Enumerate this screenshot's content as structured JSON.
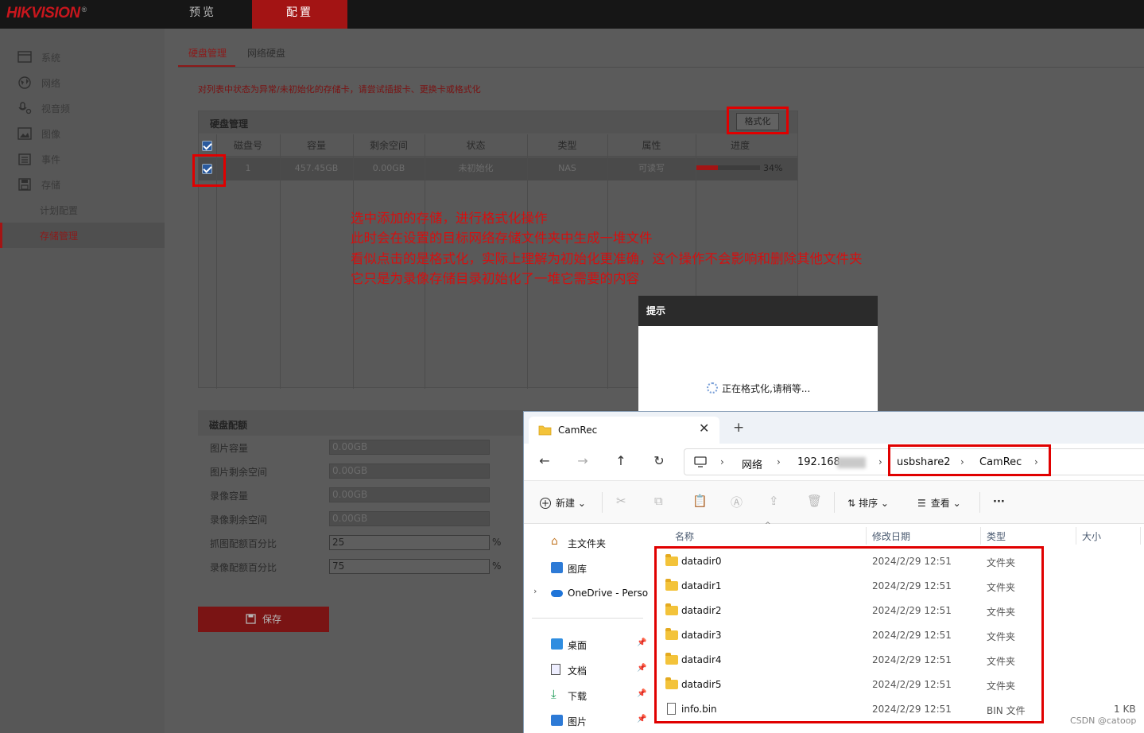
{
  "topbar": {
    "logo": "HIKVISION",
    "logo_mark": "®",
    "nav": [
      "预览",
      "配置"
    ],
    "active_nav": "配置"
  },
  "sidebar": {
    "items": [
      {
        "label": "系统",
        "icon": "monitor-icon"
      },
      {
        "label": "网络",
        "icon": "globe-icon"
      },
      {
        "label": "视音频",
        "icon": "mic-icon"
      },
      {
        "label": "图像",
        "icon": "image-icon"
      },
      {
        "label": "事件",
        "icon": "calendar-icon"
      },
      {
        "label": "存储",
        "icon": "save-icon"
      }
    ],
    "subitems": [
      "计划配置",
      "存储管理"
    ],
    "active": "存储管理"
  },
  "tabs": [
    "硬盘管理",
    "网络硬盘"
  ],
  "warning": "对列表中状态为异常/未初始化的存储卡，请尝试插拔卡、更换卡或格式化",
  "disk_panel": {
    "title": "硬盘管理",
    "format_button": "格式化",
    "columns": [
      "磁盘号",
      "容量",
      "剩余空间",
      "状态",
      "类型",
      "属性",
      "进度"
    ],
    "rows": [
      {
        "no": "1",
        "capacity": "457.45GB",
        "free": "0.00GB",
        "status": "未初始化",
        "type": "NAS",
        "attr": "可读写",
        "progress": 34,
        "progress_text": "34%"
      }
    ]
  },
  "annotation": [
    "选中添加的存储，进行格式化操作",
    "此时会在设置的目标网络存储文件夹中生成一堆文件",
    "看似点击的是格式化，实际上理解为初始化更准确，这个操作不会影响和删除其他文件夹",
    "它只是为录像存储目录初始化了一堆它需要的内容"
  ],
  "quota": {
    "title": "磁盘配额",
    "fields": [
      {
        "label": "图片容量",
        "value": "0.00GB",
        "unit": ""
      },
      {
        "label": "图片剩余空间",
        "value": "0.00GB",
        "unit": ""
      },
      {
        "label": "录像容量",
        "value": "0.00GB",
        "unit": ""
      },
      {
        "label": "录像剩余空间",
        "value": "0.00GB",
        "unit": ""
      },
      {
        "label": "抓图配额百分比",
        "value": "25",
        "unit": "%"
      },
      {
        "label": "录像配额百分比",
        "value": "75",
        "unit": "%"
      }
    ],
    "save_button": "保存"
  },
  "dialog": {
    "title": "提示",
    "message": "正在格式化,请稍等..."
  },
  "explorer": {
    "tab_title": "CamRec",
    "address": [
      "网络",
      "192.168.",
      "usbshare2",
      "CamRec"
    ],
    "toolbar": {
      "new": "新建",
      "sort": "排序",
      "view": "查看",
      "more": "···"
    },
    "sidebar": [
      {
        "label": "主文件夹",
        "icon": "home-icon",
        "pinned": false
      },
      {
        "label": "图库",
        "icon": "gallery-icon",
        "pinned": false
      },
      {
        "label": "OneDrive - Perso",
        "icon": "cloud-icon",
        "pinned": false
      },
      {
        "label": "桌面",
        "icon": "desktop-icon",
        "pinned": true
      },
      {
        "label": "文档",
        "icon": "document-icon",
        "pinned": true
      },
      {
        "label": "下载",
        "icon": "download-icon",
        "pinned": true
      },
      {
        "label": "图片",
        "icon": "pictures-icon",
        "pinned": true
      }
    ],
    "columns": [
      "名称",
      "修改日期",
      "类型",
      "大小"
    ],
    "files": [
      {
        "name": "datadir0",
        "date": "2024/2/29 12:51",
        "type": "文件夹",
        "size": "",
        "kind": "folder"
      },
      {
        "name": "datadir1",
        "date": "2024/2/29 12:51",
        "type": "文件夹",
        "size": "",
        "kind": "folder"
      },
      {
        "name": "datadir2",
        "date": "2024/2/29 12:51",
        "type": "文件夹",
        "size": "",
        "kind": "folder"
      },
      {
        "name": "datadir3",
        "date": "2024/2/29 12:51",
        "type": "文件夹",
        "size": "",
        "kind": "folder"
      },
      {
        "name": "datadir4",
        "date": "2024/2/29 12:51",
        "type": "文件夹",
        "size": "",
        "kind": "folder"
      },
      {
        "name": "datadir5",
        "date": "2024/2/29 12:51",
        "type": "文件夹",
        "size": "",
        "kind": "folder"
      },
      {
        "name": "info.bin",
        "date": "2024/2/29 12:51",
        "type": "BIN 文件",
        "size": "1 KB",
        "kind": "file"
      }
    ]
  },
  "watermark": "CSDN @catoop",
  "colors": {
    "brand_red": "#c8161d",
    "annotation_red": "#e00000",
    "active_menu": "#8c1a1a"
  }
}
